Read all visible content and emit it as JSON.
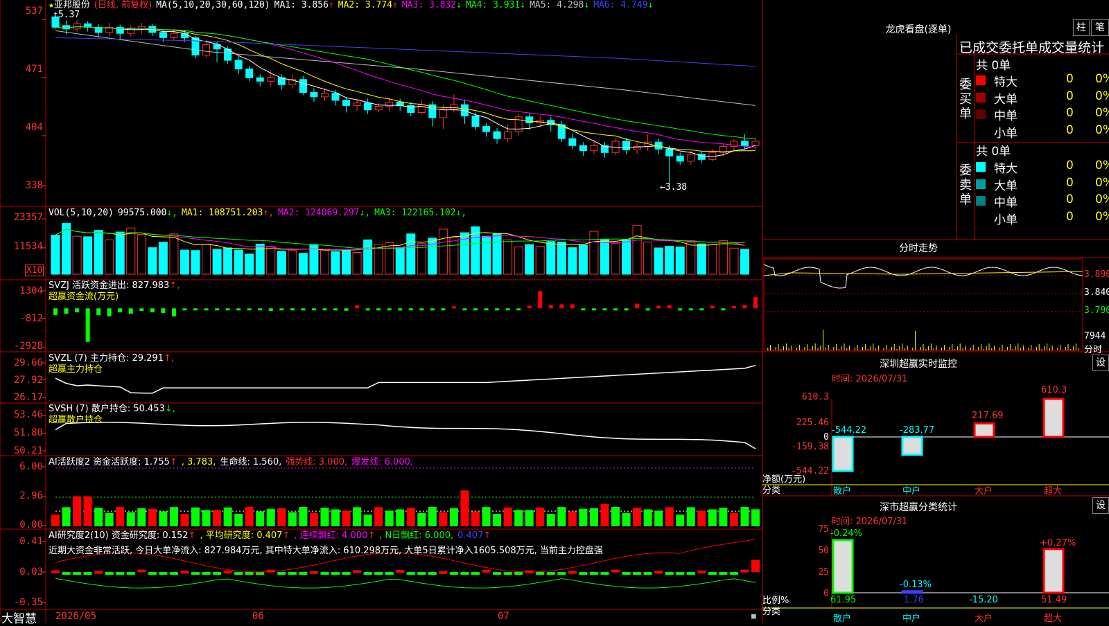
{
  "stock": {
    "star": "★",
    "name": "亚邦股份",
    "mode": "(日线, 前复权)",
    "ma_label": "MA(5,10,20,30,60,120)",
    "ma": [
      {
        "label": "MA1:",
        "value": "3.856",
        "arrow": "↑",
        "color": "#ffffff"
      },
      {
        "label": "MA2:",
        "value": "3.774",
        "arrow": "↑",
        "color": "#ffff00"
      },
      {
        "label": "MA3:",
        "value": "3.832",
        "arrow": "↓",
        "color": "#ff00ff"
      },
      {
        "label": "MA4:",
        "value": "3.931",
        "arrow": "↓",
        "color": "#00ff00"
      },
      {
        "label": "MA5:",
        "value": "4.298",
        "arrow": "↓",
        "color": "#c0c0c0"
      },
      {
        "label": "MA6:",
        "value": "4.749",
        "arrow": "↓",
        "color": "#4040ff"
      }
    ],
    "high_mark": "5.37",
    "low_mark": "3.38"
  },
  "axes": {
    "price_ticks": [
      "537",
      "471",
      "404",
      "338"
    ],
    "vol_ticks": [
      "23357",
      "11534"
    ],
    "vol_unit": "X10",
    "svzj_ticks": [
      "1304",
      "-812",
      "-2928"
    ],
    "svzl_ticks": [
      "29.66",
      "27.92",
      "26.17"
    ],
    "svsh_ticks": [
      "53.46",
      "51.80",
      "50.21"
    ],
    "ai1_ticks": [
      "6.00",
      "2.96",
      "0.00"
    ],
    "ai2_ticks": [
      "0.41",
      "0.03",
      "-0.35"
    ],
    "date_labels": [
      "2026/05",
      "06",
      "07"
    ]
  },
  "panels": {
    "vol": {
      "prefix": "VOL(5,10,20)",
      "items": [
        {
          "text": "99575.000",
          "arrow": "↓",
          "color": "#ffffff"
        },
        {
          "text": "MA1: 108751.203",
          "arrow": "↑",
          "color": "#ffff00"
        },
        {
          "text": "MA2: 124069.297",
          "arrow": "↓",
          "color": "#ff00ff"
        },
        {
          "text": "MA3: 122165.102",
          "arrow": "↓",
          "color": "#00ff00"
        }
      ]
    },
    "svzj": {
      "line1": "SVZJ  活跃资金进出: 827.983",
      "arrow": "↑,",
      "line2": "超赢资金流(万元)"
    },
    "svzl": {
      "line1": "SVZL (7) 主力持仓: 29.291",
      "arrow": "↑,",
      "line2": "超赢主力持仓"
    },
    "svsh": {
      "line1": "SVSH (7) 散户持仓: 50.453",
      "arrow": "↓,",
      "line2": "超赢散户持仓"
    },
    "ai1": {
      "items": [
        {
          "text": "AI活跃度2 资金活跃度: 1.755",
          "arrow": "↑",
          "color": "#ffffff"
        },
        {
          "text": ", 3.783,",
          "arrow": "",
          "color": "#ffff00"
        },
        {
          "text": "生命线: 1.560,",
          "arrow": "",
          "color": "#ffffff"
        },
        {
          "text": "强势线: 3.000,",
          "arrow": "",
          "color": "#ff3232"
        },
        {
          "text": "爆发线: 6.000,",
          "arrow": "",
          "color": "#ff00ff"
        }
      ]
    },
    "ai2": {
      "items": [
        {
          "text": "AI研究度2(10) 资金研究度: 0.152",
          "arrow": "↑",
          "color": "#ffffff"
        },
        {
          "text": ", 平均研究度: 0.407",
          "arrow": "↑",
          "color": "#ffff00"
        },
        {
          "text": ", 连续飘红: 4.000",
          "arrow": "↑",
          "color": "#ff00ff"
        },
        {
          "text": ", N日飘红: 6.000,",
          "arrow": "",
          "color": "#00ff00"
        },
        {
          "text": "0.407",
          "arrow": "↑",
          "color": "#4040ff"
        }
      ],
      "comment": "近期大资金非常活跃, 今日大单净流入: 827.984万元, 其中特大单净流入: 610.298万元, 大单5日累计净入1605.508万元, 当前主力控盘强"
    }
  },
  "logo": "大智慧",
  "right": {
    "dragon_title": "龙虎看盘(逐单)",
    "tab_bar": "柱",
    "tab_pen": "笔",
    "order_header": "已成交委托单成交量统计",
    "buy_side": {
      "label": "委买单",
      "total": "共 0单",
      "rows": [
        {
          "label": "特大",
          "n": "0",
          "p": "0%",
          "color": "#ff0000"
        },
        {
          "label": "大单",
          "n": "0",
          "p": "0%",
          "color": "#a00000"
        },
        {
          "label": "中单",
          "n": "0",
          "p": "0%",
          "color": "#600000"
        },
        {
          "label": "小单",
          "n": "0",
          "p": "0%",
          "color": ""
        }
      ]
    },
    "sell_side": {
      "label": "委卖单",
      "total": "共 0单",
      "rows": [
        {
          "label": "特大",
          "n": "0",
          "p": "0%",
          "color": "#00ffff"
        },
        {
          "label": "大单",
          "n": "0",
          "p": "0%",
          "color": "#00a0a0"
        },
        {
          "label": "中单",
          "n": "0",
          "p": "0%",
          "color": "#008080"
        },
        {
          "label": "小单",
          "n": "0",
          "p": "0%",
          "color": ""
        }
      ]
    },
    "fenshi": {
      "title": "分时走势",
      "ticks": [
        "3.890",
        "3.840",
        "3.790"
      ],
      "vol_tick": "7944",
      "vol_label": "分时"
    },
    "monitor": {
      "title": "深圳超赢实时监控",
      "btn": "设",
      "time": "时间: 2026/07/31",
      "ticks": [
        "610.3",
        "225.46",
        "0",
        "-159.38",
        "-544.22"
      ],
      "ylabel": "净额(万元)",
      "xlabel": "分类",
      "categories": [
        "散户",
        "中户",
        "大户",
        "超大"
      ],
      "values": [
        "-544.22",
        "-283.77",
        "217.69",
        "610.3"
      ]
    },
    "stats": {
      "title": "深市超赢分类统计",
      "btn": "设",
      "time": "时间: 2026/07/31",
      "ticks": [
        "75",
        "50",
        "25",
        "0"
      ],
      "ylabel": "比例%",
      "xlabel": "分类",
      "categories": [
        "散户",
        "中户",
        "大户",
        "超大"
      ],
      "values": [
        "61.95",
        "1.76",
        "-15.20",
        "51.49"
      ],
      "changes": [
        "-0.24%",
        "-0.13%",
        "",
        "+0.27%"
      ]
    }
  },
  "chart_data": [
    {
      "type": "candlestick",
      "title": "亚邦股份 (日线, 前复权)",
      "ylim": [
        3.38,
        5.37
      ],
      "high": 5.37,
      "low": 3.38,
      "ohlc": [
        [
          5.32,
          5.2,
          5.37,
          5.18
        ],
        [
          5.22,
          5.18,
          5.28,
          5.12
        ],
        [
          5.18,
          5.24,
          5.28,
          5.15
        ],
        [
          5.24,
          5.2,
          5.27,
          5.15
        ],
        [
          5.2,
          5.14,
          5.24,
          5.08
        ],
        [
          5.14,
          5.2,
          5.25,
          5.1
        ],
        [
          5.2,
          5.13,
          5.23,
          5.06
        ],
        [
          5.13,
          5.19,
          5.22,
          5.09
        ],
        [
          5.19,
          5.21,
          5.25,
          5.12
        ],
        [
          5.21,
          5.14,
          5.24,
          5.1
        ],
        [
          5.14,
          5.08,
          5.17,
          5.03
        ],
        [
          5.08,
          5.13,
          5.18,
          5.05
        ],
        [
          5.13,
          5.08,
          5.17,
          5.03
        ],
        [
          5.08,
          4.88,
          5.1,
          4.84
        ],
        [
          4.88,
          5.0,
          5.06,
          4.85
        ],
        [
          5.0,
          4.95,
          5.04,
          4.8
        ],
        [
          4.95,
          4.82,
          4.98,
          4.78
        ],
        [
          4.82,
          4.72,
          4.87,
          4.66
        ],
        [
          4.72,
          4.62,
          4.76,
          4.58
        ],
        [
          4.62,
          4.58,
          4.66,
          4.52
        ],
        [
          4.58,
          4.62,
          4.7,
          4.52
        ],
        [
          4.62,
          4.54,
          4.66,
          4.48
        ],
        [
          4.54,
          4.6,
          4.66,
          4.49
        ],
        [
          4.6,
          4.45,
          4.64,
          4.42
        ],
        [
          4.45,
          4.4,
          4.5,
          4.34
        ],
        [
          4.4,
          4.44,
          4.5,
          4.35
        ],
        [
          4.44,
          4.36,
          4.48,
          4.3
        ],
        [
          4.36,
          4.3,
          4.4,
          4.22
        ],
        [
          4.3,
          4.33,
          4.38,
          4.24
        ],
        [
          4.33,
          4.25,
          4.38,
          4.2
        ],
        [
          4.25,
          4.29,
          4.33,
          4.22
        ],
        [
          4.29,
          4.34,
          4.39,
          4.23
        ],
        [
          4.34,
          4.3,
          4.38,
          4.24
        ],
        [
          4.3,
          4.22,
          4.34,
          4.18
        ],
        [
          4.22,
          4.31,
          4.36,
          4.2
        ],
        [
          4.31,
          4.16,
          4.35,
          4.06
        ],
        [
          4.16,
          4.26,
          4.31,
          4.03
        ],
        [
          4.26,
          4.31,
          4.43,
          4.22
        ],
        [
          4.31,
          4.18,
          4.37,
          4.09
        ],
        [
          4.18,
          4.06,
          4.22,
          4.02
        ],
        [
          4.06,
          4.0,
          4.1,
          3.94
        ],
        [
          4.0,
          3.92,
          4.04,
          3.86
        ],
        [
          3.92,
          4.0,
          4.08,
          3.88
        ],
        [
          4.0,
          4.17,
          4.2,
          3.96
        ],
        [
          4.17,
          4.1,
          4.22,
          4.02
        ],
        [
          4.1,
          4.13,
          4.18,
          4.05
        ],
        [
          4.13,
          4.08,
          4.17,
          4.0
        ],
        [
          4.08,
          3.92,
          4.12,
          3.88
        ],
        [
          3.92,
          3.84,
          3.98,
          3.8
        ],
        [
          3.84,
          3.78,
          3.88,
          3.72
        ],
        [
          3.78,
          3.84,
          3.9,
          3.74
        ],
        [
          3.84,
          3.76,
          3.88,
          3.7
        ],
        [
          3.76,
          3.89,
          3.92,
          3.73
        ],
        [
          3.89,
          3.79,
          3.93,
          3.74
        ],
        [
          3.79,
          3.83,
          3.88,
          3.74
        ],
        [
          3.83,
          3.88,
          3.97,
          3.78
        ],
        [
          3.88,
          3.8,
          3.92,
          3.74
        ],
        [
          3.8,
          3.72,
          3.84,
          3.38
        ],
        [
          3.72,
          3.66,
          3.76,
          3.62
        ],
        [
          3.66,
          3.74,
          3.78,
          3.62
        ],
        [
          3.74,
          3.68,
          3.77,
          3.64
        ],
        [
          3.68,
          3.76,
          3.8,
          3.66
        ],
        [
          3.76,
          3.83,
          3.86,
          3.72
        ],
        [
          3.83,
          3.89,
          3.92,
          3.78
        ],
        [
          3.89,
          3.84,
          3.97,
          3.8
        ],
        [
          3.84,
          3.89,
          3.93,
          3.8
        ]
      ]
    },
    {
      "type": "bar",
      "title": "VOL(5,10,20)",
      "ylim": [
        0,
        23357
      ],
      "values": [
        16500,
        21500,
        16000,
        15800,
        18500,
        14500,
        17800,
        19500,
        16800,
        11200,
        13500,
        17000,
        10200,
        10000,
        12700,
        10500,
        11100,
        10200,
        8500,
        12700,
        11700,
        9700,
        10000,
        8800,
        12500,
        10100,
        9500,
        10200,
        9200,
        14500,
        12700,
        13300,
        11300,
        17000,
        12900,
        15200,
        19000,
        15300,
        17500,
        20000,
        16000,
        17200,
        14500,
        11500,
        12500,
        11800,
        13800,
        13500,
        11200,
        12300,
        18100,
        14800,
        12900,
        14500,
        20500,
        13600,
        11100,
        11800,
        11500,
        13500,
        12800,
        12400,
        14200,
        11000,
        10500
      ]
    },
    {
      "type": "bar",
      "title": "SVZJ 活跃资金进出",
      "ylim": [
        -2928,
        1304
      ],
      "values": [
        -500,
        -400,
        -300,
        -2500,
        -500,
        -600,
        -300,
        -400,
        -200,
        -300,
        -350,
        -600,
        -100,
        -100,
        -80,
        -120,
        -90,
        -100,
        -100,
        -80,
        -200,
        -120,
        -90,
        -100,
        -150,
        -150,
        -130,
        -180,
        220,
        -100,
        -100,
        -100,
        -100,
        -130,
        -150,
        -120,
        -150,
        150,
        -120,
        -150,
        -120,
        -80,
        -90,
        -100,
        200,
        1304,
        250,
        300,
        300,
        -150,
        -130,
        -100,
        -120,
        -160,
        350,
        -80,
        200,
        250,
        -120,
        -100,
        -130,
        200,
        -110,
        180,
        250,
        827.983
      ]
    },
    {
      "type": "line",
      "title": "SVZL 主力持仓",
      "ylim": [
        26.17,
        29.66
      ],
      "last": 29.291
    },
    {
      "type": "line",
      "title": "SVSH 散户持仓",
      "ylim": [
        50.21,
        53.46
      ],
      "last": 50.453
    },
    {
      "type": "bar",
      "title": "AI活跃度2 资金活跃度",
      "ylim": [
        0,
        6.0
      ],
      "last": 1.755,
      "lines": {
        "生命线": 1.56,
        "强势线": 3.0,
        "爆发线": 6.0
      }
    },
    {
      "type": "bar",
      "title": "AI研究度2 资金研究度",
      "ylim": [
        -0.35,
        0.41
      ],
      "last": 0.152
    },
    {
      "type": "bar",
      "title": "深圳超赢实时监控",
      "categories": [
        "散户",
        "中户",
        "大户",
        "超大"
      ],
      "values": [
        -544.22,
        -283.77,
        217.69,
        610.3
      ],
      "ylim": [
        -544.22,
        610.3
      ]
    },
    {
      "type": "bar",
      "title": "深市超赢分类统计",
      "categories": [
        "散户",
        "中户",
        "大户",
        "超大"
      ],
      "values": [
        61.95,
        1.76,
        -15.2,
        51.49
      ],
      "ylim": [
        0,
        75
      ]
    }
  ]
}
